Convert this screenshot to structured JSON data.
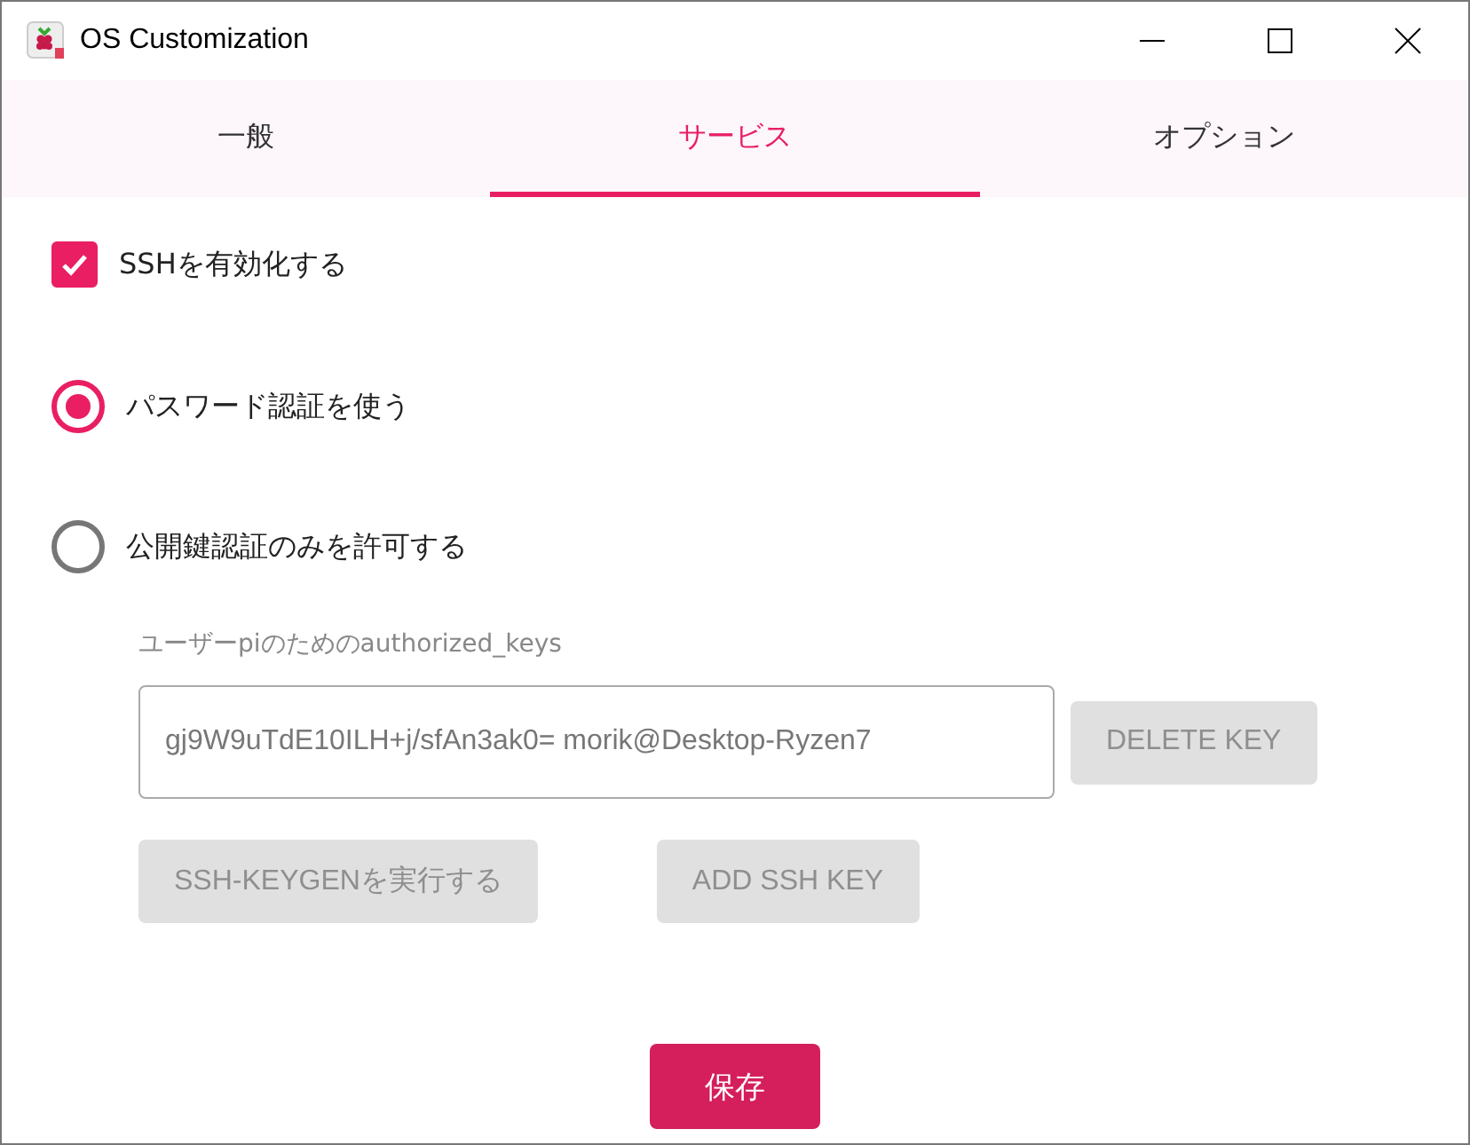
{
  "window": {
    "title": "OS Customization"
  },
  "tabs": [
    {
      "label": "一般",
      "selected": false
    },
    {
      "label": "サービス",
      "selected": true
    },
    {
      "label": "オプション",
      "selected": false
    }
  ],
  "ssh_enable": {
    "label": "SSHを有効化する",
    "checked": true
  },
  "auth": [
    {
      "label": "パスワード認証を使う",
      "selected": true
    },
    {
      "label": "公開鍵認証のみを許可する",
      "selected": false
    }
  ],
  "keys": {
    "label": "ユーザーpiのためのauthorized_keys",
    "value": "gj9W9uTdE10ILH+j/sfAn3ak0= morik@Desktop-Ryzen7",
    "delete_button": {
      "label": "DELETE KEY",
      "disabled": true
    }
  },
  "buttons": [
    {
      "label": "SSH-KEYGENを実行する",
      "disabled": true
    },
    {
      "label": "ADD SSH KEY",
      "disabled": true
    }
  ],
  "save_button": {
    "label": "保存"
  }
}
